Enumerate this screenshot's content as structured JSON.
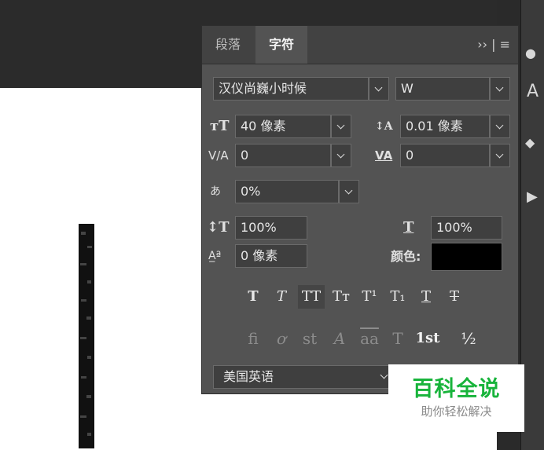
{
  "tabs": [
    {
      "label": "段落",
      "active": false
    },
    {
      "label": "字符",
      "active": true
    }
  ],
  "tab_menu": "›› | ≡",
  "font_family": "汉仪尚巍小时候",
  "font_style": "W",
  "font_size": "40 像素",
  "leading": "0.01 像素",
  "kerning": "0",
  "tracking": "0",
  "tsume": "0%",
  "vertical_scale": "100%",
  "horizontal_scale": "100%",
  "baseline_shift": "0 像素",
  "color_label": "颜色:",
  "text_color": "#000000",
  "style_buttons": [
    {
      "glyph": "T",
      "name": "faux-bold"
    },
    {
      "glyph": "T",
      "name": "faux-italic"
    },
    {
      "glyph": "TT",
      "name": "all-caps"
    },
    {
      "glyph": "Tт",
      "name": "small-caps"
    },
    {
      "glyph": "T¹",
      "name": "superscript"
    },
    {
      "glyph": "T₁",
      "name": "subscript"
    },
    {
      "glyph": "T",
      "name": "underline"
    },
    {
      "glyph": "T",
      "name": "strikethrough"
    }
  ],
  "opentype_buttons": [
    {
      "glyph": "fi",
      "name": "ligatures"
    },
    {
      "glyph": "ơ",
      "name": "discretionary-ligatures"
    },
    {
      "glyph": "st",
      "name": "swash"
    },
    {
      "glyph": "A",
      "name": "stylistic-alternates"
    },
    {
      "glyph": "aa",
      "name": "titling-alternates"
    },
    {
      "glyph": "T",
      "name": "contextual-alternates"
    },
    {
      "glyph": "1st",
      "name": "ordinals"
    },
    {
      "glyph": "½",
      "name": "fractions"
    }
  ],
  "language": "美国英语",
  "watermark": {
    "title": "百科全说",
    "subtitle": "助你轻松解决",
    "color": "#18b43b"
  },
  "colors": {
    "panel": "#535353",
    "field": "#3f3f3f",
    "text": "#e6e6e6"
  }
}
